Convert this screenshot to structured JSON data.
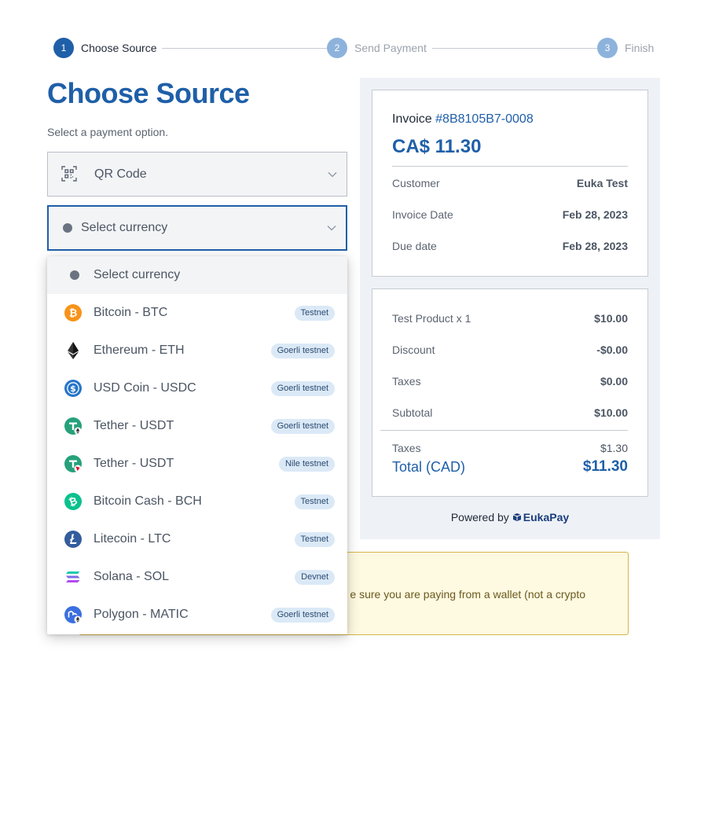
{
  "stepper": {
    "steps": [
      {
        "number": "1",
        "label": "Choose Source"
      },
      {
        "number": "2",
        "label": "Send Payment"
      },
      {
        "number": "3",
        "label": "Finish"
      }
    ]
  },
  "main": {
    "title": "Choose Source",
    "subtitle": "Select a payment option.",
    "source_select": {
      "value": "QR Code"
    },
    "currency_select": {
      "value": "Select currency"
    }
  },
  "dropdown": {
    "items": [
      {
        "label": "Select currency",
        "badge": "",
        "icon": "gray-dot-icon"
      },
      {
        "label": "Bitcoin - BTC",
        "badge": "Testnet",
        "icon": "bitcoin-icon"
      },
      {
        "label": "Ethereum - ETH",
        "badge": "Goerli testnet",
        "icon": "ethereum-icon"
      },
      {
        "label": "USD Coin - USDC",
        "badge": "Goerli testnet",
        "icon": "usdc-icon"
      },
      {
        "label": "Tether - USDT",
        "badge": "Goerli testnet",
        "icon": "tether-eth-icon"
      },
      {
        "label": "Tether - USDT",
        "badge": "Nile testnet",
        "icon": "tether-tron-icon"
      },
      {
        "label": "Bitcoin Cash - BCH",
        "badge": "Testnet",
        "icon": "bitcoin-cash-icon"
      },
      {
        "label": "Litecoin - LTC",
        "badge": "Testnet",
        "icon": "litecoin-icon"
      },
      {
        "label": "Solana - SOL",
        "badge": "Devnet",
        "icon": "solana-icon"
      },
      {
        "label": "Polygon - MATIC",
        "badge": "Goerli testnet",
        "icon": "polygon-icon"
      }
    ]
  },
  "warning": {
    "text": "e sure you are paying from a wallet (not a crypto"
  },
  "invoice": {
    "label": "Invoice",
    "id": "#8B8105B7-0008",
    "amount": "CA$ 11.30",
    "rows": [
      {
        "label": "Customer",
        "value": "Euka Test"
      },
      {
        "label": "Invoice Date",
        "value": "Feb 28, 2023"
      },
      {
        "label": "Due date",
        "value": "Feb 28, 2023"
      }
    ]
  },
  "summary": {
    "rows": [
      {
        "label": "Test Product x 1",
        "value": "$10.00"
      },
      {
        "label": "Discount",
        "value": "-$0.00"
      },
      {
        "label": "Taxes",
        "value": "$0.00"
      },
      {
        "label": "Subtotal",
        "value": "$10.00"
      }
    ],
    "taxes_label": "Taxes",
    "taxes_value": "$1.30",
    "total_label": "Total (CAD)",
    "total_value": "$11.30"
  },
  "footer": {
    "powered_by": "Powered by",
    "brand": "EukaPay"
  },
  "colors": {
    "primary": "#1f5fa8",
    "panel_bg": "#eef1f6",
    "badge_bg": "#dbe9f7",
    "warning_bg": "#fef9e1"
  }
}
